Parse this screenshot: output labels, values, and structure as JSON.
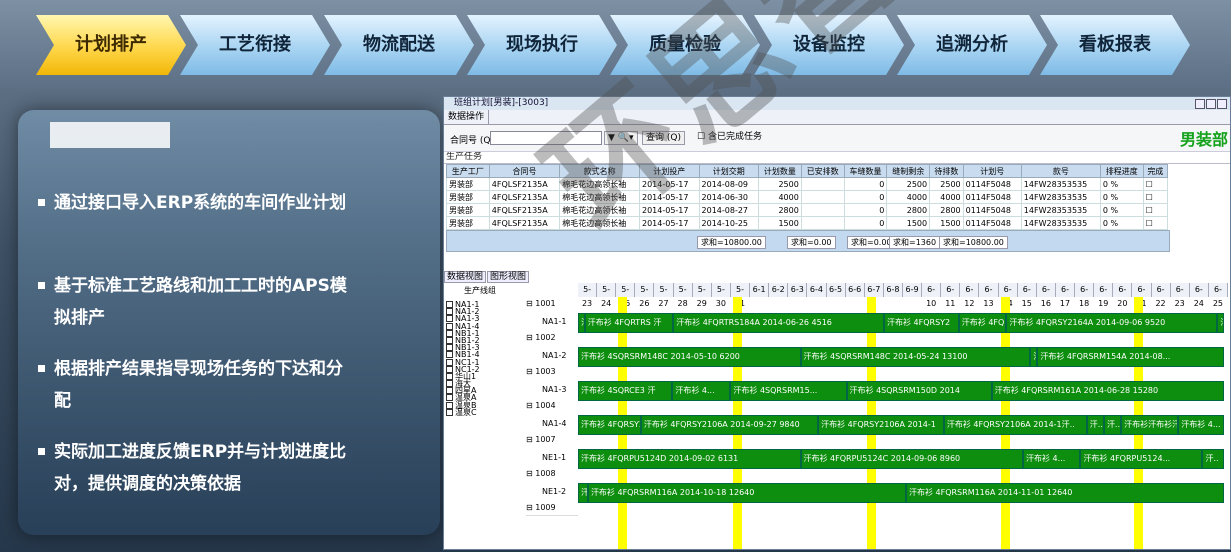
{
  "nav": {
    "steps": [
      "计划排产",
      "工艺衔接",
      "物流配送",
      "现场执行",
      "质量检验",
      "设备监控",
      "追溯分析",
      "看板报表"
    ]
  },
  "panel": {
    "bullets": [
      "通过接口导入ERP系统的车间作业计划",
      "基于标准工艺路线和加工工时的APS模拟排产",
      "根据排产结果指导现场任务的下达和分配",
      "实际加工进度反馈ERP并与计划进度比对，提供调度的决策依据"
    ]
  },
  "app": {
    "title": "班组计划[男装]-[3003]",
    "tabs": [
      "数据操作"
    ],
    "toolbar": {
      "label": "合同号 (Q)",
      "query": "查询 (Q)",
      "checkbox": "含已完成任务",
      "brand": "男装部"
    },
    "section": "生产任务",
    "columns": [
      "生产工厂",
      "合同号",
      "款式名称",
      "计划投产",
      "计划交期",
      "计划数量",
      "已安排数",
      "车缝数量",
      "缝制剩余",
      "待排数",
      "计划号",
      "款号",
      "排程进度",
      "完成"
    ],
    "rows": [
      [
        "男装部",
        "4FQLSF2135A",
        "棉毛花边高领长袖",
        "2014-05-17",
        "2014-08-09",
        "2500",
        "",
        "0",
        "2500",
        "2500",
        "0114F5048",
        "14FW28353535",
        "0 %",
        ""
      ],
      [
        "男装部",
        "4FQLSF2135A",
        "棉毛花边高领长袖",
        "2014-05-17",
        "2014-06-30",
        "4000",
        "",
        "0",
        "4000",
        "4000",
        "0114F5048",
        "14FW28353535",
        "0 %",
        ""
      ],
      [
        "男装部",
        "4FQLSF2135A",
        "棉毛花边高领长袖",
        "2014-05-17",
        "2014-08-27",
        "2800",
        "",
        "0",
        "2800",
        "2800",
        "0114F5048",
        "14FW28353535",
        "0 %",
        ""
      ],
      [
        "男装部",
        "4FQLSF2135A",
        "棉毛花边高领长袖",
        "2014-05-17",
        "2014-10-25",
        "1500",
        "",
        "0",
        "1500",
        "1500",
        "0114F5048",
        "14FW28353535",
        "0 %",
        ""
      ]
    ],
    "sums": [
      "求和=10800.00",
      "求和=0.00",
      "求和=0.00",
      "求和=1360",
      "求和=10800.00"
    ],
    "view_tabs": [
      "数据视图",
      "图形视图"
    ],
    "gantt": {
      "group_header": "生产线组",
      "days": [
        "5-23",
        "5-24",
        "5-25",
        "5-26",
        "5-27",
        "5-28",
        "5-29",
        "5-30",
        "5-31",
        "6-1",
        "6-2",
        "6-3",
        "6-4",
        "6-5",
        "6-6",
        "6-7",
        "6-8",
        "6-9",
        "6-10",
        "6-11",
        "6-12",
        "6-13",
        "6-14",
        "6-15",
        "6-16",
        "6-17",
        "6-18",
        "6-19",
        "6-20",
        "6-21",
        "6-22",
        "6-23",
        "6-24",
        "6-25"
      ],
      "checklist": [
        "NA1-1",
        "NA1-2",
        "NA1-3",
        "NA1-4",
        "NB1-1",
        "NB1-2",
        "NB1-3",
        "NB1-4",
        "NC1-1",
        "NC1-2",
        "华山1",
        "海大",
        "四星A",
        "温泉A",
        "温泉B",
        "温泉C"
      ],
      "groups": [
        {
          "code": "1001",
          "lane": "NA1-1",
          "tasks": [
            {
              "t": "汗"
            },
            {
              "t": "汗布衫 4FQRTRS 汗"
            },
            {
              "t": "汗布衫 4FQRTRS184A 2014-06-26 4516"
            },
            {
              "t": "汗布衫 4FQRSY2"
            },
            {
              "t": "汗布衫 4FQ"
            },
            {
              "t": "汗布衫 4FQRSY2164A 2014-09-06 9520"
            },
            {
              "t": "汗"
            }
          ]
        },
        {
          "code": "1002",
          "lane": "NA1-2",
          "tasks": [
            {
              "t": "汗布衫 4SQRSRM148C 2014-05-10 6200"
            },
            {
              "t": "汗布衫 4SQRSRM148C 2014-05-24 13100"
            },
            {
              "t": "汗"
            },
            {
              "t": "汗布衫 4FQRSRM154A 2014-08..."
            }
          ]
        },
        {
          "code": "1003",
          "lane": "NA1-3",
          "tasks": [
            {
              "t": "汗布衫 4SQRCE3 汗"
            },
            {
              "t": "汗布衫 4..."
            },
            {
              "t": "汗布衫 4SQRSRM15..."
            },
            {
              "t": "汗布衫 4SQRSRM150D 2014"
            },
            {
              "t": "汗布衫 4FQRSRM161A 2014-06-28 15280"
            }
          ]
        },
        {
          "code": "1004",
          "lane": "NA1-4",
          "tasks": [
            {
              "t": "汗布衫 4FQRSY2"
            },
            {
              "t": "汗布衫 4FQRSY2106A 2014-09-27 9840"
            },
            {
              "t": "汗布衫 4FQRSY2106A 2014-1"
            },
            {
              "t": "汗布衫 4FQRSY2106A 2014-1汗.."
            },
            {
              "t": "汗.."
            },
            {
              "t": "汗.."
            },
            {
              "t": "汗布衫汗布衫汗..."
            },
            {
              "t": "汗布衫 4..."
            }
          ]
        },
        {
          "code": "1007",
          "lane": "NE1-1",
          "tasks": [
            {
              "t": "汗布衫 4FQRPU5124D 2014-09-02 6131"
            },
            {
              "t": "汗布衫 4FQRPU5124C 2014-09-06 8960"
            },
            {
              "t": "汗布衫 4..."
            },
            {
              "t": "汗布衫 4FQRPU5124..."
            },
            {
              "t": "汗.."
            }
          ]
        },
        {
          "code": "1008",
          "lane": "NE1-2",
          "tasks": [
            {
              "t": "汗"
            },
            {
              "t": "汗布衫 4FQRSRM116A 2014-10-18 12640"
            },
            {
              "t": "汗布衫 4FQRSRM116A 2014-11-01 12640"
            }
          ]
        },
        {
          "code": "1009",
          "lane": "",
          "tasks": []
        }
      ]
    }
  },
  "watermark": "环思智慧"
}
